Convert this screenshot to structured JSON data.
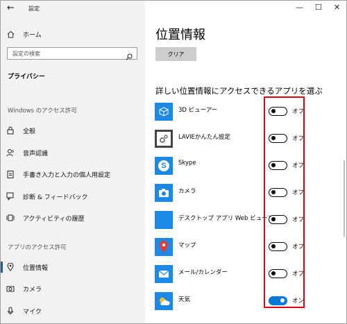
{
  "window": {
    "title": "設定",
    "controls": {
      "minimize": "—",
      "maximize": "☐",
      "close": "✕"
    }
  },
  "sidebar": {
    "home_label": "ホーム",
    "search_placeholder": "設定の検索",
    "section_title": "プライバシー",
    "windows_permissions_label": "Windows のアクセス許可",
    "windows_items": [
      {
        "label": "全般",
        "icon": "lock-icon"
      },
      {
        "label": "音声認識",
        "icon": "speech-icon"
      },
      {
        "label": "手書き入力と入力の個人用設定",
        "icon": "clipboard-icon"
      },
      {
        "label": "診断 & フィードバック",
        "icon": "feedback-icon"
      },
      {
        "label": "アクティビティの履歴",
        "icon": "history-icon"
      }
    ],
    "app_permissions_label": "アプリのアクセス許可",
    "app_items": [
      {
        "label": "位置情報",
        "icon": "location-icon",
        "active": true
      },
      {
        "label": "カメラ",
        "icon": "camera-icon"
      },
      {
        "label": "マイク",
        "icon": "microphone-icon"
      }
    ]
  },
  "main": {
    "title": "位置情報",
    "clear_button": "クリア",
    "subheading": "詳しい位置情報にアクセスできるアプリを選ぶ",
    "apps": [
      {
        "name": "3D ビューアー",
        "state": "オフ",
        "on": false,
        "icon": "3d-viewer-icon"
      },
      {
        "name": "LAVIEかんたん設定",
        "state": "オフ",
        "on": false,
        "icon": "gear-icon"
      },
      {
        "name": "Skype",
        "state": "オフ",
        "on": false,
        "icon": "skype-icon"
      },
      {
        "name": "カメラ",
        "state": "オフ",
        "on": false,
        "icon": "camera-icon"
      },
      {
        "name": "デスクトップ アプリ Web ビューアー",
        "state": "オフ",
        "on": false,
        "icon": "web-viewer-icon"
      },
      {
        "name": "マップ",
        "state": "オフ",
        "on": false,
        "icon": "map-pin-icon"
      },
      {
        "name": "メール/カレンダー",
        "state": "オフ",
        "on": false,
        "icon": "mail-icon"
      },
      {
        "name": "天気",
        "state": "オン",
        "on": true,
        "icon": "weather-icon"
      }
    ]
  },
  "colors": {
    "accent": "#0078d7",
    "highlight_box": "#e00012",
    "tile": "#1e88e5"
  }
}
